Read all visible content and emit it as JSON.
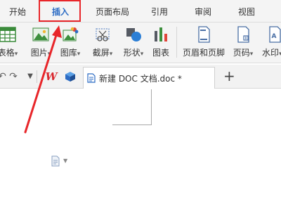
{
  "menu": {
    "tabs": [
      {
        "label": "开始"
      },
      {
        "label": "插入"
      },
      {
        "label": "页面布局"
      },
      {
        "label": "引用"
      },
      {
        "label": "审阅"
      },
      {
        "label": "视图"
      }
    ],
    "active_tab": "插入"
  },
  "ribbon": {
    "items": [
      {
        "label": "表格",
        "icon": "table-icon",
        "dropdown": true
      },
      {
        "label": "图片",
        "icon": "picture-icon",
        "dropdown": true
      },
      {
        "label": "图库",
        "icon": "gallery-icon",
        "dropdown": true
      },
      {
        "label": "截屏",
        "icon": "screenshot-icon",
        "dropdown": true
      },
      {
        "label": "形状",
        "icon": "shapes-icon",
        "dropdown": true
      },
      {
        "label": "图表",
        "icon": "chart-icon",
        "dropdown": false
      },
      {
        "label": "页眉和页脚",
        "icon": "header-footer-icon",
        "dropdown": false
      },
      {
        "label": "页码",
        "icon": "page-number-icon",
        "dropdown": true
      },
      {
        "label": "水印",
        "icon": "watermark-icon",
        "dropdown": true
      }
    ],
    "dropdown_glyph": "▾"
  },
  "tabstrip": {
    "doc_tab_title": "新建 DOC 文档.doc *",
    "new_tab_glyph": "+",
    "wps_logo_text": "W"
  },
  "colors": {
    "accent": "#2c6cc4",
    "highlight": "#e8262a",
    "wps_red": "#d9282f"
  }
}
